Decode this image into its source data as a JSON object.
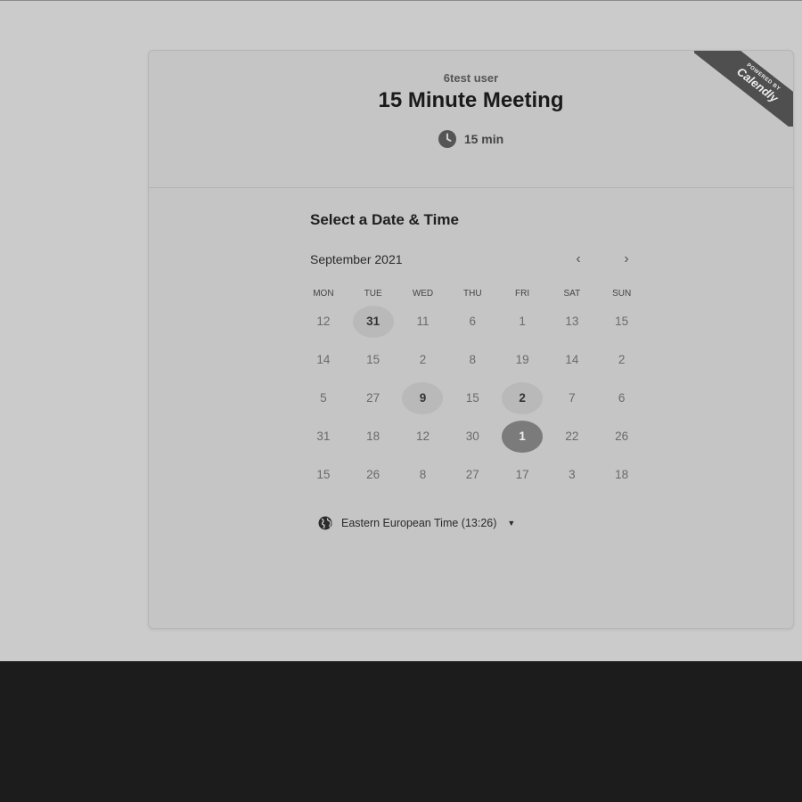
{
  "header": {
    "host_name": "6test user",
    "event_title": "15 Minute Meeting",
    "duration": "15 min",
    "duration_icon": "clock-icon"
  },
  "badge": {
    "powered_by": "POWERED BY",
    "brand": "Calendly"
  },
  "calendar": {
    "section_title": "Select a Date & Time",
    "month_label": "September 2021",
    "prev_icon": "chevron-left-icon",
    "next_icon": "chevron-right-icon",
    "weekdays": [
      "MON",
      "TUE",
      "WED",
      "THU",
      "FRI",
      "SAT",
      "SUN"
    ],
    "weeks": [
      [
        {
          "d": "12",
          "s": "disabled"
        },
        {
          "d": "31",
          "s": "available"
        },
        {
          "d": "11",
          "s": "disabled"
        },
        {
          "d": "6",
          "s": "disabled"
        },
        {
          "d": "1",
          "s": "disabled"
        },
        {
          "d": "13",
          "s": "disabled"
        },
        {
          "d": "15",
          "s": "disabled"
        }
      ],
      [
        {
          "d": "14",
          "s": "disabled"
        },
        {
          "d": "15",
          "s": "disabled"
        },
        {
          "d": "2",
          "s": "disabled"
        },
        {
          "d": "8",
          "s": "disabled"
        },
        {
          "d": "19",
          "s": "disabled"
        },
        {
          "d": "14",
          "s": "disabled"
        },
        {
          "d": "2",
          "s": "disabled"
        }
      ],
      [
        {
          "d": "5",
          "s": "disabled"
        },
        {
          "d": "27",
          "s": "disabled"
        },
        {
          "d": "9",
          "s": "available"
        },
        {
          "d": "15",
          "s": "disabled"
        },
        {
          "d": "2",
          "s": "available"
        },
        {
          "d": "7",
          "s": "disabled"
        },
        {
          "d": "6",
          "s": "disabled"
        }
      ],
      [
        {
          "d": "31",
          "s": "disabled"
        },
        {
          "d": "18",
          "s": "disabled"
        },
        {
          "d": "12",
          "s": "disabled"
        },
        {
          "d": "30",
          "s": "disabled"
        },
        {
          "d": "1",
          "s": "selected"
        },
        {
          "d": "22",
          "s": "disabled"
        },
        {
          "d": "26",
          "s": "disabled"
        }
      ],
      [
        {
          "d": "15",
          "s": "disabled"
        },
        {
          "d": "26",
          "s": "disabled"
        },
        {
          "d": "8",
          "s": "disabled"
        },
        {
          "d": "27",
          "s": "disabled"
        },
        {
          "d": "17",
          "s": "disabled"
        },
        {
          "d": "3",
          "s": "disabled"
        },
        {
          "d": "18",
          "s": "disabled"
        }
      ]
    ]
  },
  "timezone": {
    "label": "Eastern European Time (13:26)",
    "icon": "globe-icon"
  }
}
